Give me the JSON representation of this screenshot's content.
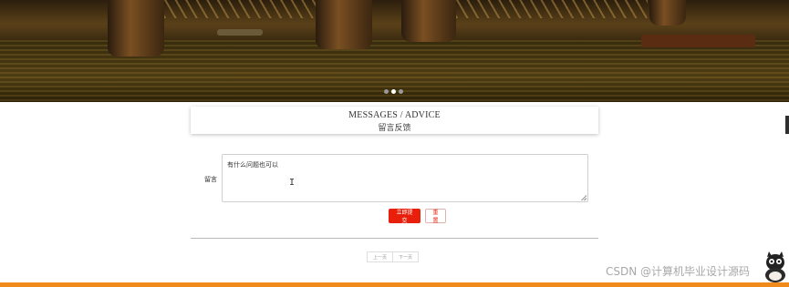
{
  "hero": {
    "carousel_dots": [
      {
        "active": false
      },
      {
        "active": true
      },
      {
        "active": false
      }
    ]
  },
  "section": {
    "title_en": "MESSAGES / ADVICE",
    "title_cn": "留言反馈"
  },
  "form": {
    "message_label": "留言",
    "message_value": "有什么问题也可以",
    "submit_label": "立即提交",
    "reset_label": "重置"
  },
  "pagination": {
    "prev_label": "上一页",
    "next_label": "下一页"
  },
  "watermark": {
    "text": "CSDN @计算机毕业设计源码"
  },
  "colors": {
    "accent_red": "#e8200b",
    "footer_orange": "#f08a1a"
  }
}
